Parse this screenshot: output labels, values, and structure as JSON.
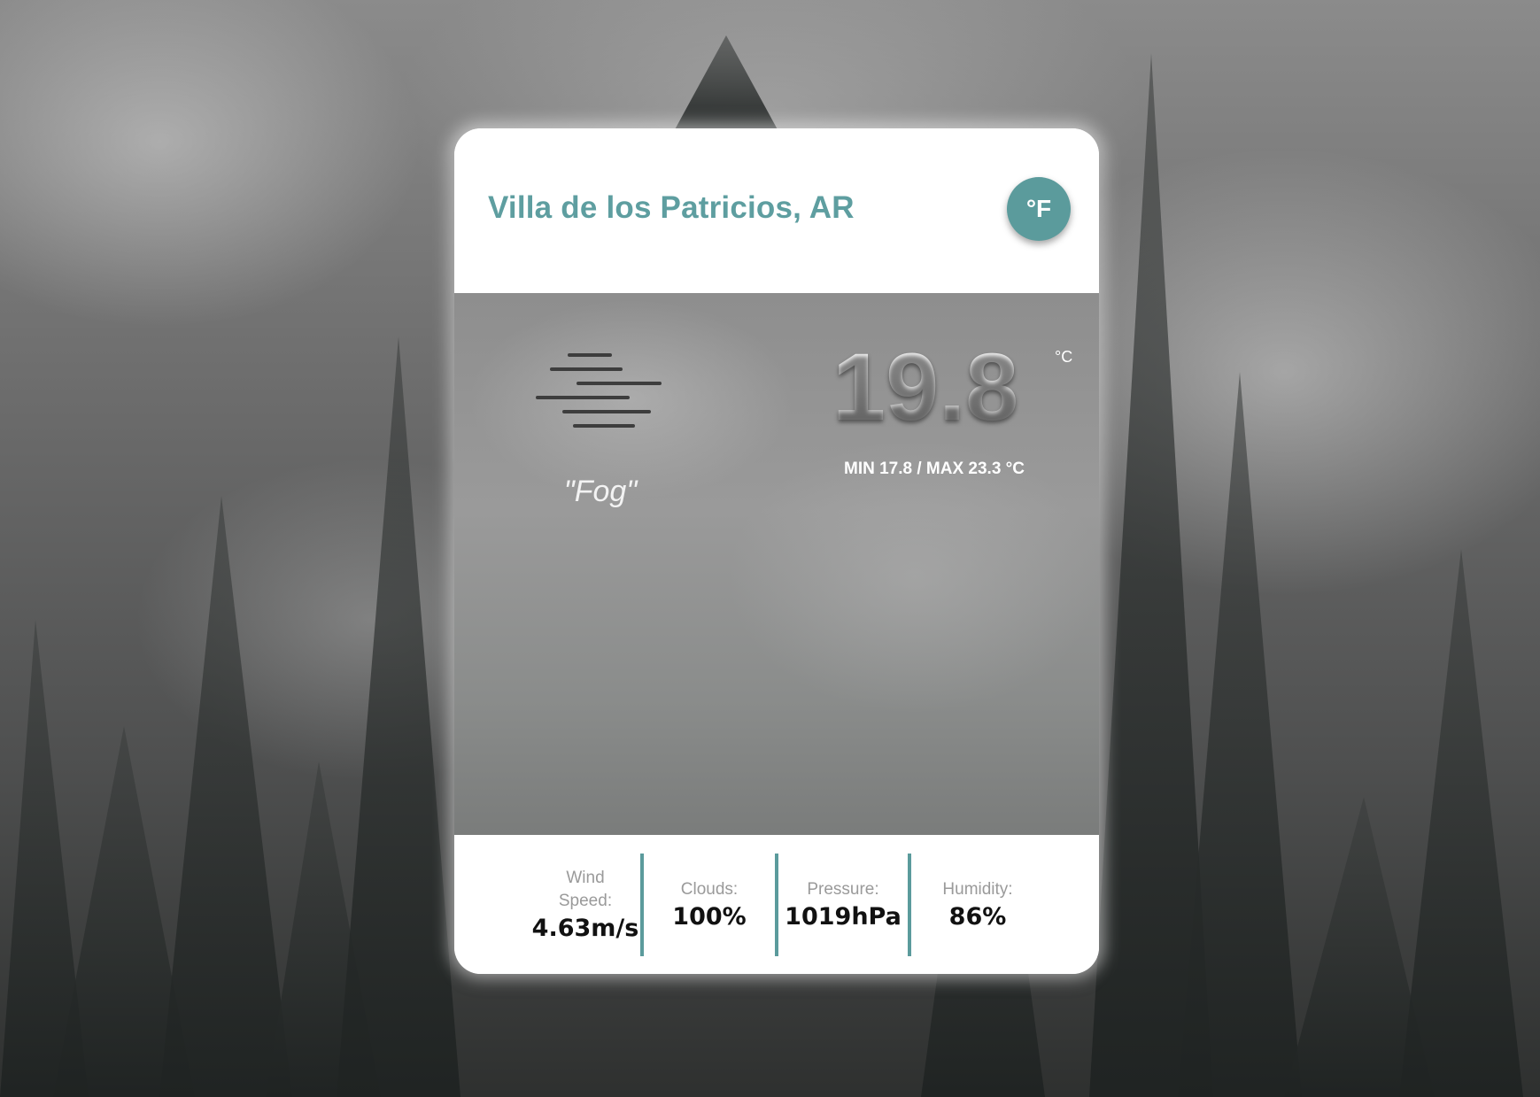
{
  "location": {
    "city": "Villa de los Patricios, AR"
  },
  "unit_toggle": {
    "label": "°F"
  },
  "current": {
    "description": "\"Fog\"",
    "temperature": "19.8",
    "temperature_unit": "°C",
    "min_max": "MIN 17.8 / MAX 23.3 °C",
    "icon": "fog-icon"
  },
  "stats": [
    {
      "label": "Wind Speed:",
      "value": "4.63m/s"
    },
    {
      "label": "Clouds:",
      "value": "100%"
    },
    {
      "label": "Pressure:",
      "value": "1019hPa"
    },
    {
      "label": "Humidity:",
      "value": "86%"
    }
  ],
  "colors": {
    "accent": "#5b9b9c",
    "city_text": "#5e9ea0"
  }
}
